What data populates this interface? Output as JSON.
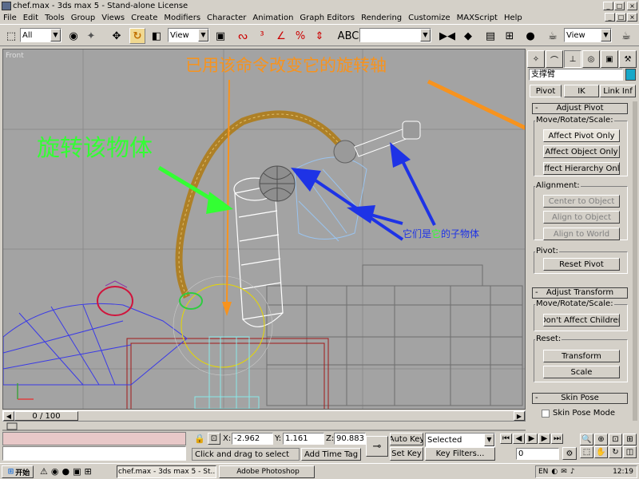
{
  "window": {
    "title": "chef.max - 3ds max 5 - Stand-alone License"
  },
  "menu": [
    "File",
    "Edit",
    "Tools",
    "Group",
    "Views",
    "Create",
    "Modifiers",
    "Character",
    "Animation",
    "Graph Editors",
    "Rendering",
    "Customize",
    "MAXScript",
    "Help"
  ],
  "toolbar": {
    "selection_filter": "All",
    "ref_coord": "View",
    "named_selection": "",
    "view_combo": "View"
  },
  "viewport": {
    "label": "Front",
    "annotation_top": "已用该命令改变它的旋转轴",
    "annotation_left": "旋转该物体",
    "annotation_right_a": "它们是",
    "annotation_right_b": "它",
    "annotation_right_c": "的子物体",
    "colors": {
      "orange": "#f7931e",
      "green": "#33ff33",
      "blue": "#1e33e6",
      "grid": "#a3a3a3"
    }
  },
  "panel": {
    "object_name": "支撑臂",
    "tabs": {
      "pivot": "Pivot",
      "ik": "IK",
      "link": "Link Inf"
    },
    "adjust_pivot": {
      "title": "Adjust Pivot",
      "move_label": "Move/Rotate/Scale:",
      "btn_pivot": "Affect Pivot Only",
      "btn_object": "Affect Object Only",
      "btn_hierarchy": "Affect Hierarchy Only",
      "align_label": "Alignment:",
      "btn_center": "Center to Object",
      "btn_align_obj": "Align to Object",
      "btn_align_world": "Align to World",
      "pivot_label": "Pivot:",
      "btn_reset": "Reset Pivot"
    },
    "adjust_transform": {
      "title": "Adjust Transform",
      "move_label": "Move/Rotate/Scale:",
      "btn_children": "Don't Affect Children",
      "reset_label": "Reset:",
      "btn_transform": "Transform",
      "btn_scale": "Scale"
    },
    "skin_pose": {
      "title": "Skin Pose",
      "checkbox": "Skin Pose Mode"
    }
  },
  "timeline": {
    "frame": "0 / 100"
  },
  "status": {
    "x_label": "X:",
    "x": "-2.962",
    "y_label": "Y:",
    "y": "1.161",
    "z_label": "Z:",
    "z": "90.883",
    "prompt": "Click and drag to select",
    "add_time_tag": "Add Time Tag",
    "auto_key": "Auto Key",
    "set_key": "Set Key",
    "key_mode": "Selected",
    "key_filters": "Key Filters...",
    "current_frame": "0"
  },
  "taskbar": {
    "start": "开始",
    "task_max": "chef.max - 3ds max 5 - St...",
    "task_ps": "Adobe Photoshop",
    "lang": "EN",
    "time": "12:19"
  }
}
